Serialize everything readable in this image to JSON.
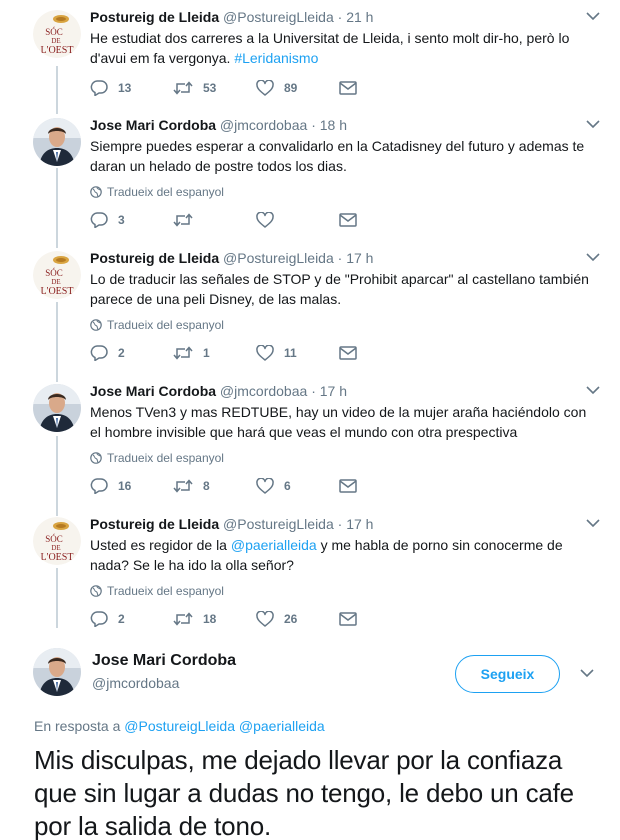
{
  "tweets": [
    {
      "author": "Postureig de Lleida",
      "handle": "@PostureigLleida",
      "time": "21 h",
      "avatar": "posture-logo",
      "text_parts": [
        "He estudiat dos carreres a la Universitat de Lleida, i sento molt dir-ho, però lo d'avui em fa vergonya. ",
        "#Leridanismo",
        ""
      ],
      "translate": "",
      "replies": "13",
      "retweets": "53",
      "likes": "89"
    },
    {
      "author": "Jose Mari Cordoba",
      "handle": "@jmcordobaa",
      "time": "18 h",
      "avatar": "person-photo",
      "text_parts": [
        "Siempre puedes esperar a convalidarlo en la Catadisney del futuro y ademas te daran un helado de postre todos los dias.",
        "",
        ""
      ],
      "translate": "Tradueix del espanyol",
      "replies": "3",
      "retweets": "",
      "likes": ""
    },
    {
      "author": "Postureig de Lleida",
      "handle": "@PostureigLleida",
      "time": "17 h",
      "avatar": "posture-logo",
      "text_parts": [
        "Lo de traducir las señales de STOP y de \"Prohibit aparcar\" al castellano también parece de una peli Disney, de las malas.",
        "",
        ""
      ],
      "translate": "Tradueix del espanyol",
      "replies": "2",
      "retweets": "1",
      "likes": "11"
    },
    {
      "author": "Jose Mari Cordoba",
      "handle": "@jmcordobaa",
      "time": "17 h",
      "avatar": "person-photo",
      "text_parts": [
        "Menos TVen3 y mas REDTUBE, hay un video de la mujer araña haciéndolo con el hombre invisible que hará que veas el mundo con otra prespectiva",
        "",
        ""
      ],
      "translate": "Tradueix del espanyol",
      "replies": "16",
      "retweets": "8",
      "likes": "6"
    },
    {
      "author": "Postureig de Lleida",
      "handle": "@PostureigLleida",
      "time": "17 h",
      "avatar": "posture-logo",
      "text_parts": [
        "Usted es regidor de la ",
        "@paerialleida",
        " y me habla de porno sin conocerme de nada? Se le ha ido la olla señor?"
      ],
      "translate": "Tradueix del espanyol",
      "replies": "2",
      "retweets": "18",
      "likes": "26"
    }
  ],
  "main_tweet": {
    "author": "Jose Mari Cordoba",
    "handle": "@jmcordobaa",
    "follow_label": "Segueix",
    "reply_prefix": "En resposta a ",
    "reply_users": "@PostureigLleida @paerialleida",
    "text": "Mis disculpas, me dejado llevar por la confiaza que sin lugar a dudas no tengo, le debo un cafe por la salida de tono."
  },
  "colors": {
    "accent": "#1da1f2",
    "text": "#14171a",
    "secondary": "#657786",
    "thread_line": "#ccd6dd"
  },
  "icons": [
    "reply-icon",
    "retweet-icon",
    "like-icon",
    "message-icon",
    "globe-icon",
    "chevron-down-icon"
  ]
}
